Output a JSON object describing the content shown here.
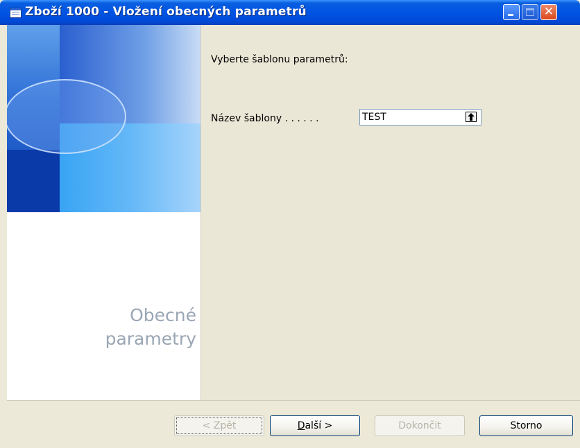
{
  "window": {
    "title": "Zboží 1000 - Vložení obecných parametrů",
    "controls": {
      "minimize": "minimize-icon",
      "maximize": "maximize-icon",
      "close": "close-icon",
      "close_glyph": "✕"
    }
  },
  "side_panel": {
    "label_line1": "Obecné",
    "label_line2": "parametry"
  },
  "content": {
    "instruction": "Vyberte šablonu parametrů:",
    "field_label": "Název šablony . . . . . .",
    "field_value": "TEST",
    "lookup_icon": "up-arrow-icon"
  },
  "buttons": {
    "back": {
      "label": "< Zpět",
      "enabled": false
    },
    "next": {
      "label_mnemonic": "D",
      "label_rest": "alší >",
      "enabled": true
    },
    "finish": {
      "label": "Dokončit",
      "enabled": false
    },
    "cancel": {
      "label": "Storno",
      "enabled": true
    }
  },
  "colors": {
    "titlebar": "#0054e3",
    "dialog_background": "#ece9d8",
    "side_label": "#9aa6b4"
  }
}
